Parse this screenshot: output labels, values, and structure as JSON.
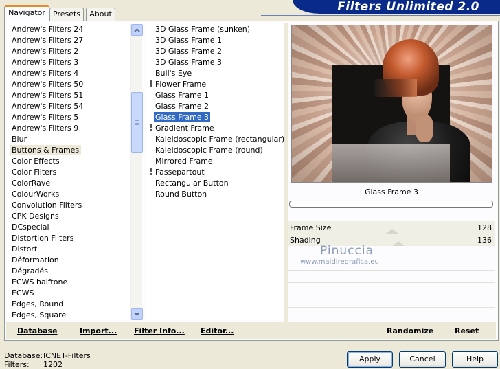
{
  "tabs": [
    "Navigator",
    "Presets",
    "About"
  ],
  "app_title": "Filters Unlimited 2.0",
  "categories": {
    "selected_index": 12,
    "items": [
      "Andrew's Filters 24",
      "Andrew's Filters 27",
      "Andrew's Filters 2",
      "Andrew's Filters 3",
      "Andrew's Filters 4",
      "Andrew's Filters 50",
      "Andrew's Filters 51",
      "Andrew's Filters 54",
      "Andrew's Filters 5",
      "Andrew's Filters 9",
      "Blur",
      "Buttons & Frames",
      "Color Effects",
      "Color Filters",
      "ColorRave",
      "ColourWorks",
      "Convolution Filters",
      "CPK Designs",
      "DCspecial",
      "Distortion Filters",
      "Distort",
      "Déformation",
      "Dégradés",
      "ECWS halftone",
      "ECWS",
      "Edges, Round",
      "Edges, Square"
    ]
  },
  "filters": {
    "items": [
      {
        "label": "3D Glass Frame (sunken)",
        "marked": false
      },
      {
        "label": "3D Glass Frame 1",
        "marked": false
      },
      {
        "label": "3D Glass Frame 2",
        "marked": false
      },
      {
        "label": "3D Glass Frame 3",
        "marked": false
      },
      {
        "label": "Bull's Eye",
        "marked": false
      },
      {
        "label": "Flower Frame",
        "marked": true
      },
      {
        "label": "Glass Frame 1",
        "marked": false
      },
      {
        "label": "Glass Frame 2",
        "marked": false
      },
      {
        "label": "Glass Frame 3",
        "marked": false,
        "selected": true
      },
      {
        "label": "Gradient Frame",
        "marked": true
      },
      {
        "label": "Kaleidoscopic Frame (rectangular)",
        "marked": false
      },
      {
        "label": "Kaleidoscopic Frame (round)",
        "marked": false
      },
      {
        "label": "Mirrored Frame",
        "marked": false
      },
      {
        "label": "Passepartout",
        "marked": true
      },
      {
        "label": "Rectangular Button",
        "marked": false
      },
      {
        "label": "Round Button",
        "marked": false
      }
    ]
  },
  "left_toolbar": {
    "database": "Database",
    "import": "Import...",
    "filter_info": "Filter Info...",
    "editor": "Editor..."
  },
  "right_toolbar": {
    "randomize": "Randomize",
    "reset": "Reset"
  },
  "preview": {
    "label": "Glass Frame 3"
  },
  "params": [
    {
      "label": "Frame Size",
      "value": "128",
      "level": 0.502
    },
    {
      "label": "Shading",
      "value": "136",
      "level": 0.533
    }
  ],
  "watermark": {
    "name": "Pinuccia",
    "site": "www.maidiregrafica.eu"
  },
  "status": {
    "database_label": "Database:",
    "database_value": "ICNET-Filters",
    "filters_label": "Filters:",
    "filters_value": "1202"
  },
  "dialog": {
    "apply": "Apply",
    "cancel": "Cancel",
    "help": "Help"
  }
}
